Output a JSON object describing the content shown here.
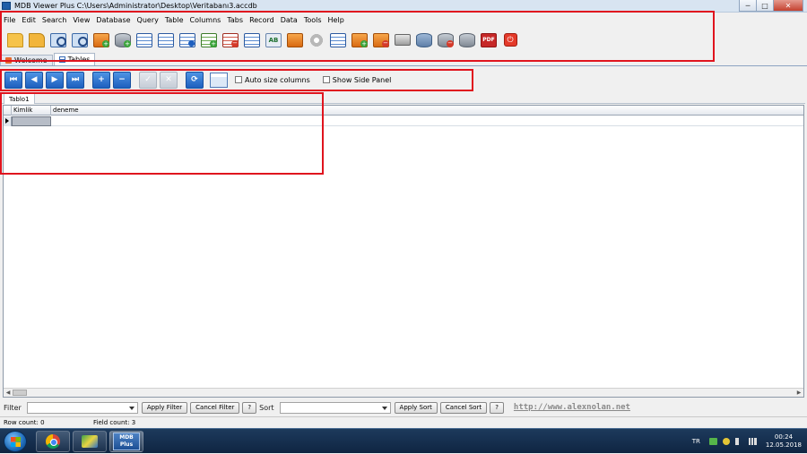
{
  "window": {
    "title": "MDB Viewer Plus C:\\Users\\Administrator\\Desktop\\Veritabanı3.accdb",
    "min_glyph": "─",
    "max_glyph": "□",
    "close_glyph": "✕"
  },
  "menu": [
    "File",
    "Edit",
    "Search",
    "View",
    "Database",
    "Query",
    "Table",
    "Columns",
    "Tabs",
    "Record",
    "Data",
    "Tools",
    "Help"
  ],
  "toolbar": {
    "icons": [
      "open-folder-icon",
      "open-recent-icon",
      "search-database-icon",
      "find-icon",
      "sql-query-add-icon",
      "database-add-icon",
      "copy-tables-icon",
      "table-structure-icon",
      "table-info-icon",
      "table-add-icon",
      "table-delete-icon",
      "edit-table-icon",
      "rename-ab-icon",
      "export-icon",
      "settings-gear-icon",
      "import-icon",
      "export-add-icon",
      "export-delete-icon",
      "print-icon",
      "database-tools-icon",
      "database-remove-icon",
      "database-gray-icon",
      "pdf-icon",
      "exit-power-icon"
    ],
    "pdf_label": "PDF",
    "power_glyph": "⏻"
  },
  "doc_tabs": [
    {
      "label": "Welcome",
      "active": false
    },
    {
      "label": "Tables",
      "active": true
    }
  ],
  "nav": {
    "first": "⏮",
    "prev": "◀",
    "next": "▶",
    "last": "⏭",
    "add": "+",
    "remove": "−",
    "post": "✓",
    "cancel": "✕",
    "refresh": "⟳",
    "auto_size_label": "Auto size columns",
    "side_panel_label": "Show Side Panel"
  },
  "table_tab": "Tablo1",
  "grid": {
    "columns": [
      "Kimlik",
      "deneme"
    ]
  },
  "filter": {
    "filter_label": "Filter",
    "apply_filter": "Apply Filter",
    "cancel_filter": "Cancel Filter",
    "help": "?",
    "sort_label": "Sort",
    "apply_sort": "Apply Sort",
    "cancel_sort": "Cancel Sort",
    "help2": "?",
    "website": "http://www.alexnolan.net"
  },
  "status": {
    "row_count": "Row count: 0",
    "field_count": "Field count: 3"
  },
  "taskbar": {
    "mdb_label_1": "MDB",
    "mdb_label_2": "Plus",
    "language": "TR",
    "time": "00:24",
    "date": "12.05.2018"
  },
  "colors": {
    "annotation": "#e0141e",
    "nav_button": "#1d5fbf",
    "link": "#8a8a8a"
  }
}
